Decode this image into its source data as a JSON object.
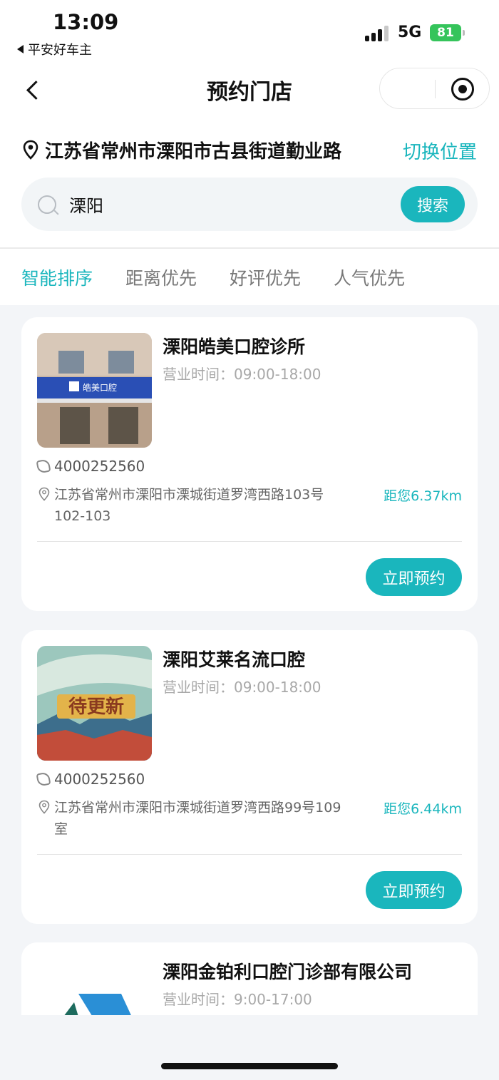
{
  "status_bar": {
    "time": "13:09",
    "back_app": "平安好车主",
    "network": "5G",
    "battery": "81"
  },
  "nav": {
    "title": "预约门店"
  },
  "location": {
    "address": "江苏省常州市溧阳市古县街道勤业路",
    "switch_label": "切换位置"
  },
  "search": {
    "value": "溧阳",
    "button_label": "搜索"
  },
  "sort_tabs": [
    {
      "label": "智能排序",
      "active": true
    },
    {
      "label": "距离优先",
      "active": false
    },
    {
      "label": "好评优先",
      "active": false
    },
    {
      "label": "人气优先",
      "active": false
    }
  ],
  "stores": [
    {
      "name": "溧阳皓美口腔诊所",
      "hours": "营业时间：09:00-18:00",
      "phone": "4000252560",
      "address": "江苏省常州市溧阳市溧城街道罗湾西路103号102-103",
      "distance": "距您6.37km",
      "book_label": "立即预约",
      "thumb_text": "皓美口腔"
    },
    {
      "name": "溧阳艾莱名流口腔",
      "hours": "营业时间：09:00-18:00",
      "phone": "4000252560",
      "address": "江苏省常州市溧阳市溧城街道罗湾西路99号109室",
      "distance": "距您6.44km",
      "book_label": "立即预约",
      "thumb_text": "待更新"
    },
    {
      "name": "溧阳金铂利口腔门诊部有限公司",
      "hours": "营业时间：9:00-17:00"
    }
  ],
  "colors": {
    "accent": "#1ab6bd",
    "battery": "#35c45b",
    "background": "#f3f5f8"
  }
}
